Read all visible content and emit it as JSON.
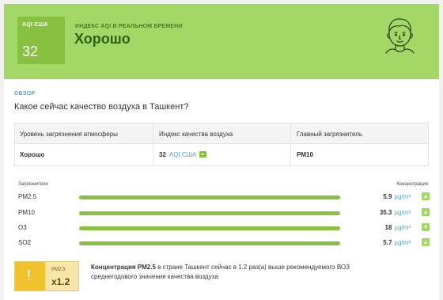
{
  "hero": {
    "aqi_label": "AQI США",
    "aqi_value": "32",
    "subtitle": "ИНДЕКС AQI В РЕАЛЬНОМ ВРЕМЕНИ",
    "status": "Хорошо",
    "avatar_icon": "face-icon",
    "colors": {
      "background": "#a3d867",
      "box": "#87c13f",
      "status_text": "#2f5f12"
    }
  },
  "overview": {
    "label": "ОБЗОР",
    "question": "Какое сейчас качество воздуха в Ташкент?"
  },
  "summary_table": {
    "headers": [
      "Уровень загрязнения атмосферы",
      "Индекс качества воздуха",
      "Главный загрязнитель"
    ],
    "level": "Хорошо",
    "aqi_value": "32",
    "aqi_unit": "AQI США",
    "main_pollutant": "PM10"
  },
  "pollutants": {
    "header_left": "Загрязнители",
    "header_right": "Концентрация",
    "unit": "µg/m³",
    "rows": [
      {
        "name": "PM2.5",
        "value": "5.9",
        "level": 1.0,
        "trend": "up"
      },
      {
        "name": "PM10",
        "value": "35.3",
        "level": 1.0,
        "trend": "up"
      },
      {
        "name": "O3",
        "value": "18",
        "level": 1.0,
        "trend": "down"
      },
      {
        "name": "SO2",
        "value": "5.7",
        "level": 1.0,
        "trend": "up"
      }
    ]
  },
  "alert": {
    "icon": "exclamation-icon",
    "pollutant": "PM2.5",
    "multiplier": "x1.2",
    "text_bold": "Концентрация PM2.5",
    "text_rest": " в стране Ташкент сейчас в 1.2 раз(а) выше рекомендуемого ВОЗ среднегодового значения качества воздуха"
  }
}
